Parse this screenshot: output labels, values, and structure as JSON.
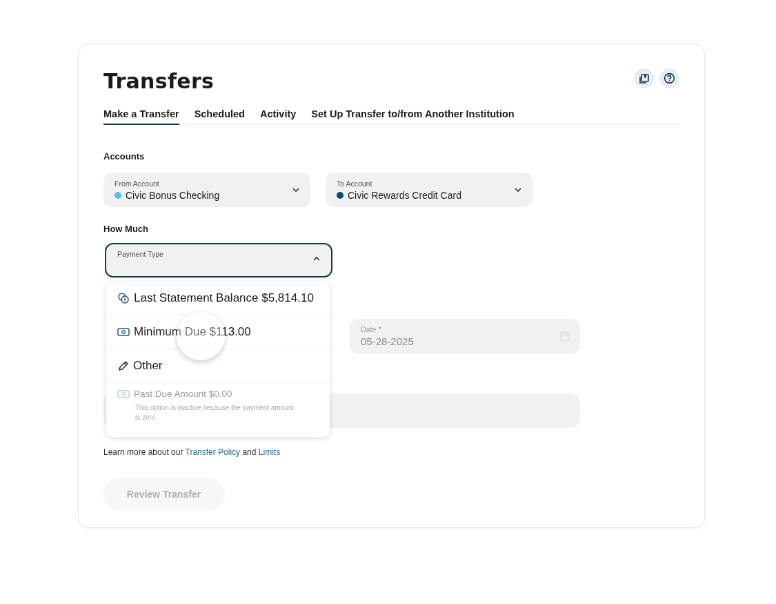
{
  "page": {
    "title": "Transfers"
  },
  "tabs": [
    {
      "label": "Make a Transfer",
      "selected": true
    },
    {
      "label": "Scheduled",
      "selected": false
    },
    {
      "label": "Activity",
      "selected": false
    },
    {
      "label": "Set Up Transfer to/from Another Institution",
      "selected": false
    }
  ],
  "accounts": {
    "heading": "Accounts",
    "fields": [
      {
        "label": "From Account",
        "value": "Civic Bonus Checking",
        "color": "#4fc3e8"
      },
      {
        "label": "To Account",
        "value": "Civic Rewards Credit Card",
        "color": "#0d4a6b"
      }
    ]
  },
  "how_much": {
    "heading": "How Much",
    "payment_type": {
      "label": "Payment Type",
      "expanded": true,
      "options": [
        {
          "kind": "coins",
          "label": "Last Statement Balance $5,814.10",
          "disabled": false
        },
        {
          "kind": "cash",
          "label": "Minimum Due $113.00",
          "disabled": false
        },
        {
          "kind": "pencil",
          "label": "Other",
          "disabled": false
        },
        {
          "kind": "cash",
          "label": "Past Due Amount $0.00",
          "disabled": true,
          "note": "This option is inactive because the payment amount is zero."
        }
      ]
    }
  },
  "date_field": {
    "label": "Date",
    "required_mark": "*",
    "value": "05-28-2025"
  },
  "policy_note": [
    {
      "kind": "text",
      "text": "Learn more about our "
    },
    {
      "kind": "link",
      "text": "Transfer Policy"
    },
    {
      "kind": "text",
      "text": " and "
    },
    {
      "kind": "link",
      "text": "Limits"
    }
  ],
  "review_button": {
    "label": "Review Transfer",
    "disabled": true
  }
}
